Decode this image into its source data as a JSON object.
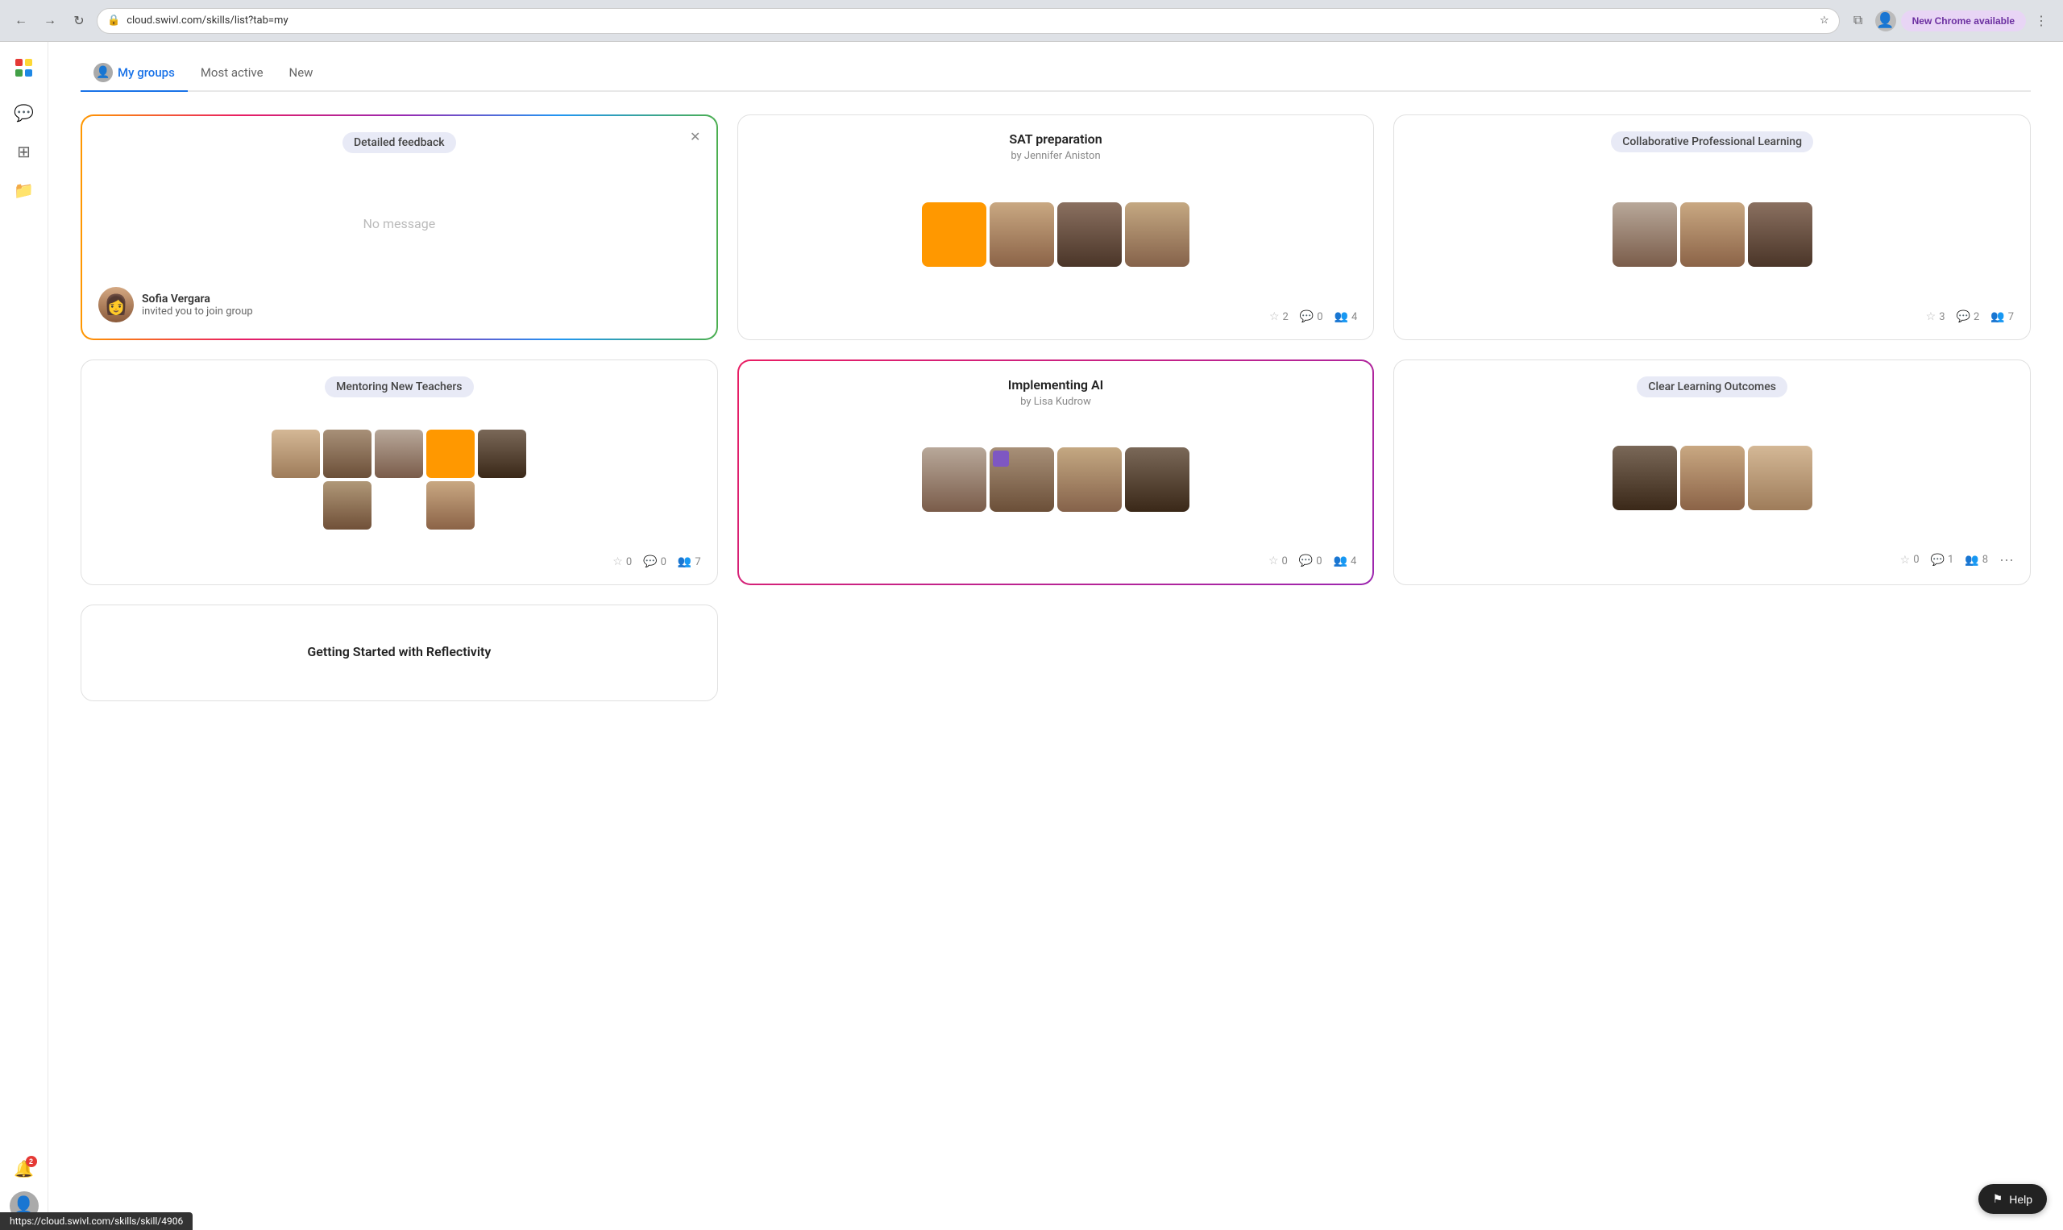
{
  "browser": {
    "url": "cloud.swivl.com/skills/list?tab=my",
    "new_chrome_label": "New Chrome available",
    "more_options": "⋮"
  },
  "tabs": [
    {
      "id": "my-groups",
      "label": "My groups",
      "active": true
    },
    {
      "id": "most-active",
      "label": "Most active",
      "active": false
    },
    {
      "id": "new",
      "label": "New",
      "active": false
    }
  ],
  "cards": [
    {
      "id": "detailed-feedback",
      "tag": "Detailed feedback",
      "no_message": "No message",
      "invite_name": "Sofia Vergara",
      "invite_text": "invited you to join group",
      "highlight": "rainbow",
      "closeable": true
    },
    {
      "id": "sat-preparation",
      "title": "SAT preparation",
      "subtitle": "by Jennifer Aniston",
      "tag": null,
      "stats": {
        "stars": 2,
        "comments": 0,
        "members": 4
      },
      "highlight": false
    },
    {
      "id": "collaborative-professional-learning",
      "title": "Collaborative Professional Learning",
      "subtitle": null,
      "tag": null,
      "stats": {
        "stars": 3,
        "comments": 2,
        "members": 7
      },
      "highlight": false
    },
    {
      "id": "mentoring-new-teachers",
      "title": "Mentoring New Teachers",
      "tag": "Mentoring New Teachers",
      "subtitle": null,
      "stats": {
        "stars": 0,
        "comments": 0,
        "members": 7
      },
      "highlight": false
    },
    {
      "id": "implementing-ai",
      "title": "Implementing AI",
      "subtitle": "by Lisa Kudrow",
      "tag": null,
      "stats": {
        "stars": 0,
        "comments": 0,
        "members": 4
      },
      "highlight": "purple"
    },
    {
      "id": "clear-learning-outcomes",
      "title": "Clear Learning Outcomes",
      "tag": "Clear Learning Outcomes",
      "subtitle": null,
      "stats": {
        "stars": 0,
        "comments": 1,
        "members": 8
      },
      "highlight": false,
      "has_more": true
    }
  ],
  "bottom_cards": [
    {
      "id": "getting-started",
      "title": "Getting Started with Reflectivity"
    }
  ],
  "sidebar": {
    "notification_badge": "2"
  },
  "help_label": "⚑ Help",
  "status_url": "https://cloud.swivl.com/skills/skill/4906"
}
